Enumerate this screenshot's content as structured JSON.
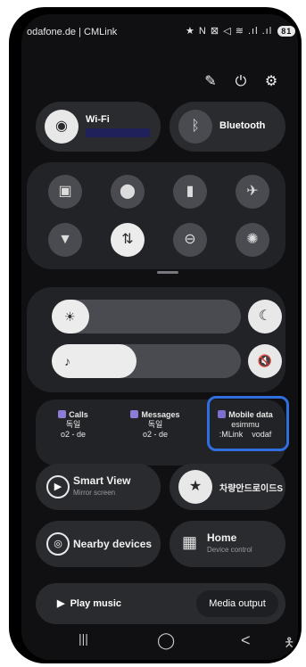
{
  "status_bar": {
    "carrier": "odafone.de | CMLink",
    "icons_text": "★ N ⊠ ◁ ≋ .ıl .ıl",
    "battery": "81"
  },
  "top_actions": {
    "edit_icon": "✎",
    "power_icon": "⏻",
    "settings_icon": "⚙"
  },
  "tiles": {
    "wifi": {
      "label": "Wi-Fi",
      "icon": "wifi-icon",
      "glyph": "◉",
      "accent": "#20215a"
    },
    "bluetooth": {
      "label": "Bluetooth",
      "icon": "bluetooth-icon",
      "glyph": "ᛒ"
    }
  },
  "quick_grid": [
    {
      "icon": "screen-lock-icon",
      "glyph": "▣"
    },
    {
      "icon": "location-icon",
      "glyph": "⬤"
    },
    {
      "icon": "battery-saver-icon",
      "glyph": "▮"
    },
    {
      "icon": "airplane-mode-icon",
      "glyph": "✈"
    },
    {
      "icon": "flashlight-icon",
      "glyph": "▼"
    },
    {
      "icon": "data-transfer-icon",
      "glyph": "⇅"
    },
    {
      "icon": "do-not-disturb-icon",
      "glyph": "⊖"
    },
    {
      "icon": "eye-comfort-icon",
      "glyph": "✺"
    }
  ],
  "sliders": {
    "brightness": {
      "icon": "brightness-icon",
      "glyph": "☀",
      "level": 0.2
    },
    "volume": {
      "icon": "volume-icon",
      "glyph": "♪",
      "level": 0.45
    },
    "dark_mode_icon": "☾",
    "mute_icon": "🔇"
  },
  "sim_manager": {
    "calls": {
      "title": "Calls",
      "line1": "독일",
      "line2": "o2 - de"
    },
    "messages": {
      "title": "Messages",
      "line1": "독일",
      "line2": "o2 - de"
    },
    "mobile_data": {
      "title": "Mobile data",
      "line1": "esimmu",
      "line2": ":MLink    vodaf"
    }
  },
  "smart_view": {
    "label": "Smart View",
    "sub": "Mirror screen",
    "glyph": "▶"
  },
  "shortcut_tile": {
    "label": "차량안드로이드S",
    "glyph": "★"
  },
  "nearby": {
    "label": "Nearby devices",
    "glyph": "◎"
  },
  "home": {
    "label": "Home",
    "sub": "Device control",
    "glyph": "▦"
  },
  "media": {
    "play": "▶  Play music",
    "output": "Media output"
  },
  "nav": {
    "recents": "|||",
    "home": "◯",
    "back": "<",
    "accessibility": "🯅"
  },
  "colors": {
    "highlight": "#2f6fe0",
    "wifi_active": "#e8e8e8"
  }
}
